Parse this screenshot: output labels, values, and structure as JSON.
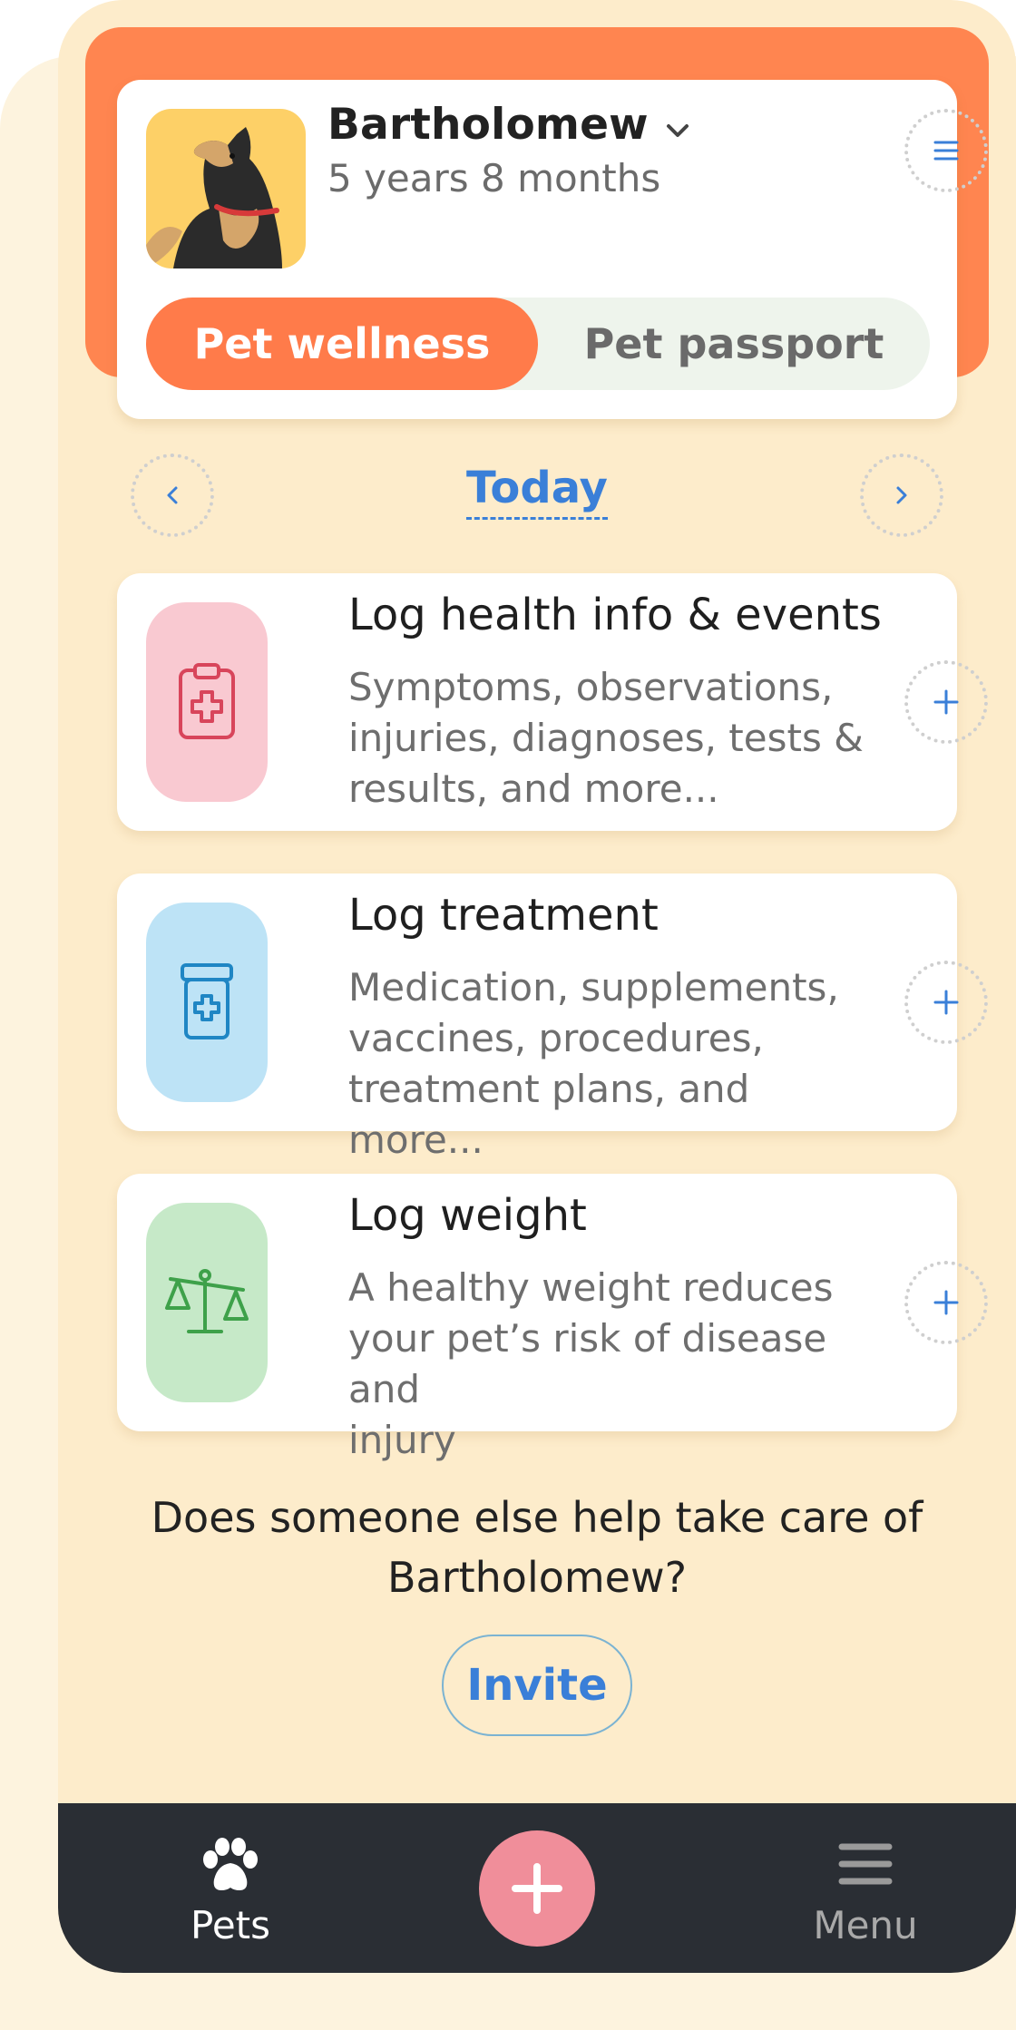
{
  "pet": {
    "name": "Bartholomew",
    "age": "5 years 8 months"
  },
  "tabs": {
    "wellness": "Pet wellness",
    "passport": "Pet passport",
    "active": "wellness"
  },
  "date_nav": {
    "label": "Today"
  },
  "log_cards": [
    {
      "title": "Log health info & events",
      "desc_lines": [
        "Symptoms, observations,",
        "injuries, diagnoses, tests &",
        "results, and more..."
      ],
      "icon": "clipboard-medical-icon",
      "icon_bg": "#f9c9d1",
      "icon_color": "#d8455b"
    },
    {
      "title": "Log treatment",
      "desc_lines": [
        "Medication, supplements,",
        "vaccines, procedures,",
        "treatment plans, and more..."
      ],
      "icon": "medicine-bottle-icon",
      "icon_bg": "#bde3f6",
      "icon_color": "#1f86c4"
    },
    {
      "title": "Log weight",
      "desc_lines": [
        "A healthy weight reduces",
        "your pet’s risk of disease and",
        "injury"
      ],
      "icon": "weight-scale-icon",
      "icon_bg": "#c6e9c8",
      "icon_color": "#3ea14a"
    }
  ],
  "caregiver": {
    "line1": "Does someone else help take care of",
    "line2": "Bartholomew?",
    "invite_label": "Invite"
  },
  "bottom_nav": {
    "pets_label": "Pets",
    "menu_label": "Menu"
  },
  "colors": {
    "accent_orange": "#ff7b4a",
    "link_blue": "#3a7fd8",
    "background": "#fdeccb",
    "tabbar": "#2a2e34",
    "fab": "#f08e9a"
  }
}
